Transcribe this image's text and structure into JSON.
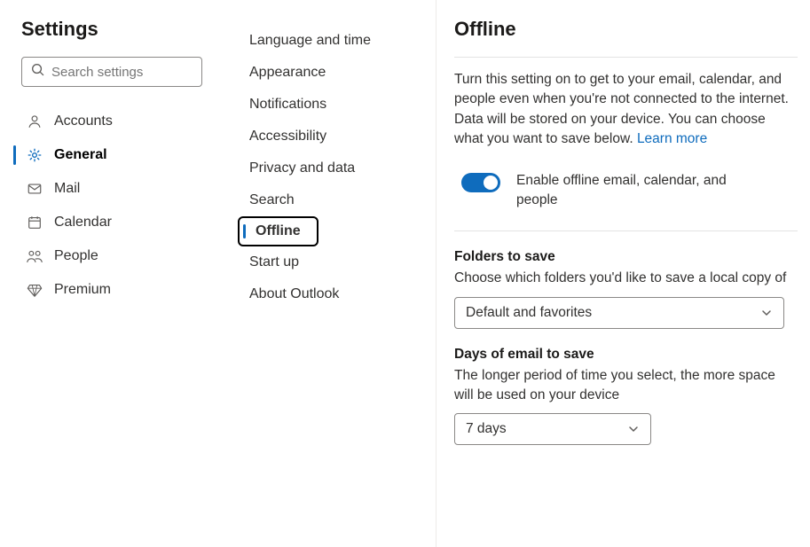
{
  "title": "Settings",
  "search": {
    "placeholder": "Search settings"
  },
  "categories": [
    {
      "id": "accounts",
      "label": "Accounts",
      "icon": "person",
      "active": false
    },
    {
      "id": "general",
      "label": "General",
      "icon": "gear",
      "active": true
    },
    {
      "id": "mail",
      "label": "Mail",
      "icon": "mail",
      "active": false
    },
    {
      "id": "calendar",
      "label": "Calendar",
      "icon": "calendar",
      "active": false
    },
    {
      "id": "people",
      "label": "People",
      "icon": "people",
      "active": false
    },
    {
      "id": "premium",
      "label": "Premium",
      "icon": "diamond",
      "active": false
    }
  ],
  "subcategories": [
    {
      "id": "lang",
      "label": "Language and time",
      "active": false
    },
    {
      "id": "appearance",
      "label": "Appearance",
      "active": false
    },
    {
      "id": "notifications",
      "label": "Notifications",
      "active": false
    },
    {
      "id": "accessibility",
      "label": "Accessibility",
      "active": false
    },
    {
      "id": "privacy",
      "label": "Privacy and data",
      "active": false
    },
    {
      "id": "search",
      "label": "Search",
      "active": false
    },
    {
      "id": "offline",
      "label": "Offline",
      "active": true
    },
    {
      "id": "startup",
      "label": "Start up",
      "active": false
    },
    {
      "id": "about",
      "label": "About Outlook",
      "active": false
    }
  ],
  "page": {
    "heading": "Offline",
    "description": "Turn this setting on to get to your email, calendar, and people even when you're not connected to the internet. Data will be stored on your device. You can choose what you want to save below. ",
    "learn_more": "Learn more",
    "toggle": {
      "enabled": true,
      "label": "Enable offline email, calendar, and people"
    },
    "folders": {
      "title": "Folders to save",
      "desc": "Choose which folders you'd like to save a local copy of",
      "value": "Default and favorites"
    },
    "days": {
      "title": "Days of email to save",
      "desc": "The longer period of time you select, the more space will be used on your device",
      "value": "7 days"
    }
  }
}
